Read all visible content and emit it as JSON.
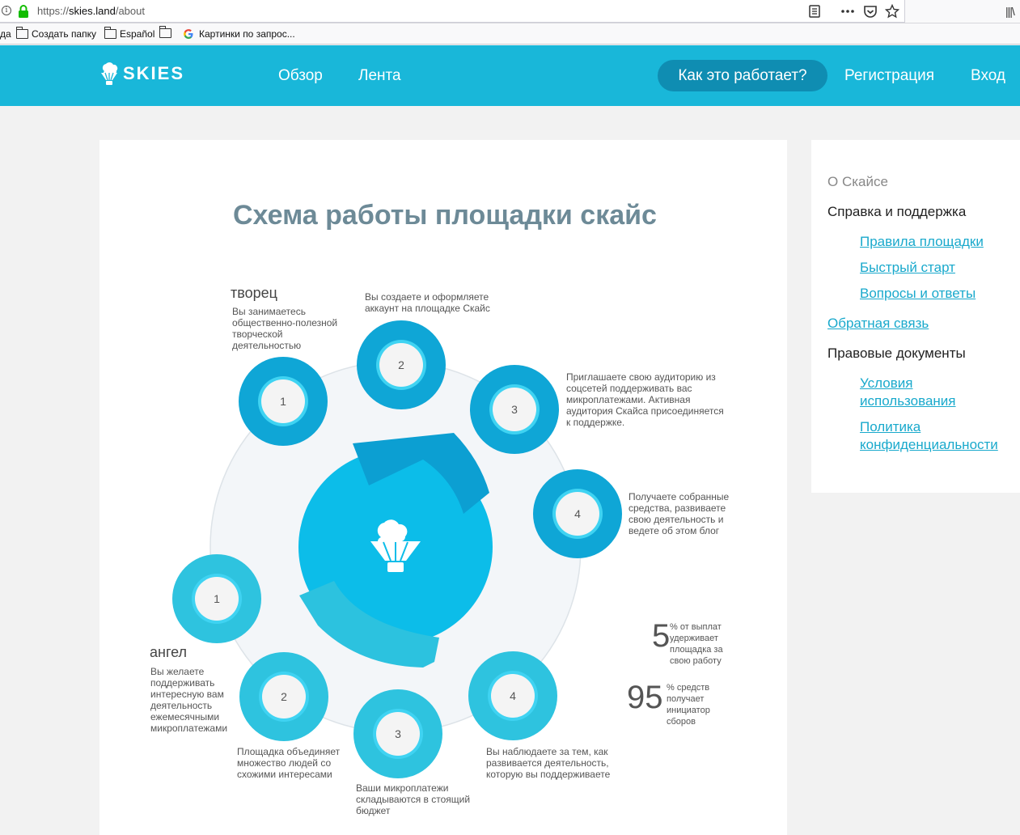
{
  "browser": {
    "url_prefix": "https://",
    "url_host": "skies.land",
    "url_path": "/about",
    "bookmark_partial": "да",
    "bookmarks": [
      {
        "label": "Создать папку",
        "icon": "folder-icon"
      },
      {
        "label": "Español",
        "icon": "folder-icon"
      },
      {
        "label": "",
        "icon": "folder-icon"
      },
      {
        "label": "Картинки по запрос...",
        "icon": "google-icon"
      }
    ]
  },
  "header": {
    "logo_text": "SKIES",
    "nav": [
      "Обзор",
      "Лента"
    ],
    "how_button": "Как это работает?",
    "register": "Регистрация",
    "login": "Вход",
    "color": "#19b7d9"
  },
  "main": {
    "title": "Схема работы площадки скайс",
    "creator": {
      "role": "творец",
      "role_text": "Вы занимаетесь общественно-полезной творческой деятельностью",
      "steps": [
        {
          "num": "1",
          "text": ""
        },
        {
          "num": "2",
          "text": "Вы создаете и оформляете аккаунт на площадке Скайс"
        },
        {
          "num": "3",
          "text": "Приглашаете свою аудиторию из соцсетей поддерживать вас микроплатежами. Активная аудитория Скайса присоединяется к поддержке."
        },
        {
          "num": "4",
          "text": "Получаете собранные средства, развиваете свою деятельность и ведете об этом блог"
        }
      ],
      "color": "#0fa6d6"
    },
    "angel": {
      "role": "ангел",
      "role_text": "Вы желаете поддерживать интересную вам деятельность ежемесячными микроплатежами",
      "steps": [
        {
          "num": "1",
          "text": ""
        },
        {
          "num": "2",
          "text": "Площадка объединяет множество людей со схожими интересами"
        },
        {
          "num": "3",
          "text": "Ваши микроплатежи складываются в стоящий бюджет"
        },
        {
          "num": "4",
          "text": "Вы наблюдаете за тем, как развивается деятельность, которую вы поддерживаете"
        }
      ],
      "color": "#2ec3df"
    },
    "stats": [
      {
        "value": "5",
        "text": "% от выплат удерживает площадка за свою работу"
      },
      {
        "value": "95",
        "text": "% средств получает инициатор сборов"
      }
    ]
  },
  "sidebar": {
    "about": "О Скайсе",
    "help": "Справка и поддержка",
    "help_links": [
      "Правила площадки",
      "Быстрый старт",
      "Вопросы и ответы"
    ],
    "feedback": "Обратная связь",
    "legal": "Правовые документы",
    "legal_links": [
      "Условия использования",
      "Политика конфиденциальности"
    ]
  }
}
